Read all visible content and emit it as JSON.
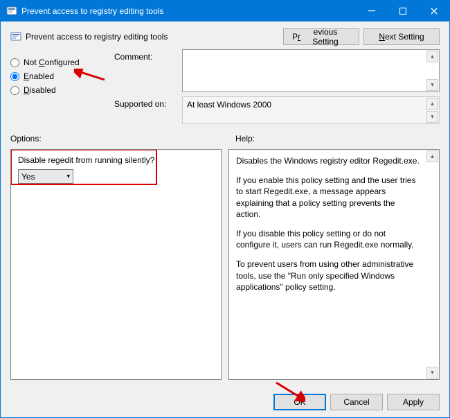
{
  "titlebar": {
    "title": "Prevent access to registry editing tools"
  },
  "header": {
    "policy_title": "Prevent access to registry editing tools",
    "prev_button_pre": "P",
    "prev_button_u": "r",
    "prev_button_post": "evious Setting",
    "next_button_u": "N",
    "next_button_post": "ext Setting"
  },
  "radios": {
    "not_configured_pre": "Not ",
    "not_configured_u": "C",
    "not_configured_post": "onfigured",
    "enabled_u": "E",
    "enabled_post": "nabled",
    "disabled_u": "D",
    "disabled_post": "isabled",
    "selected": "enabled"
  },
  "fields": {
    "comment_label": "Comment:",
    "comment_value": "",
    "supported_label": "Supported on:",
    "supported_value": "At least Windows 2000"
  },
  "panels": {
    "options_label": "Options:",
    "help_label": "Help:"
  },
  "options": {
    "question": "Disable regedit from running silently?",
    "value": "Yes"
  },
  "help": {
    "p1": "Disables the Windows registry editor Regedit.exe.",
    "p2": "If you enable this policy setting and the user tries to start Regedit.exe, a message appears explaining that a policy setting prevents the action.",
    "p3": "If you disable this policy setting or do not configure it, users can run Regedit.exe normally.",
    "p4": "To prevent users from using other administrative tools, use the \"Run only specified Windows applications\" policy setting."
  },
  "footer": {
    "ok": "OK",
    "cancel": "Cancel",
    "apply": "Apply"
  }
}
